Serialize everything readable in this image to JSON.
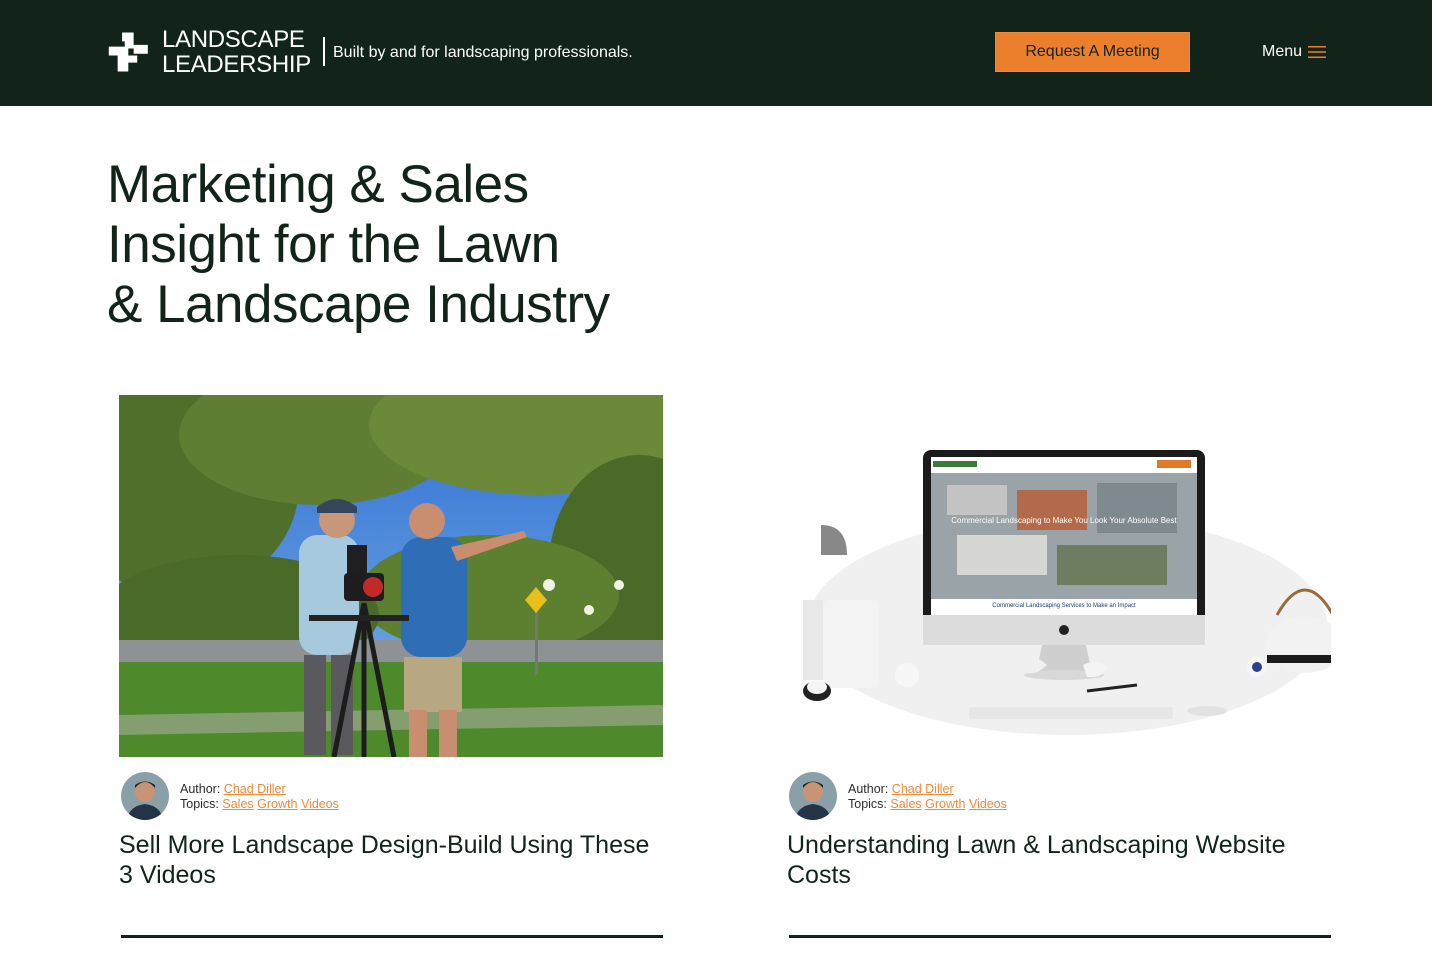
{
  "header": {
    "logo_line1": "LANDSCAPE",
    "logo_line2": "LEADERSHIP",
    "tagline": "Built by and for landscaping professionals.",
    "cta_label": "Request A Meeting",
    "menu_label": "Menu",
    "menu_icon": "hamburger-icon",
    "colors": {
      "bg": "#12241a",
      "accent": "#ec7f2c"
    }
  },
  "page": {
    "title_line1": "Marketing & Sales",
    "title_line2": "Insight for the Lawn",
    "title_line3": "& Landscape Industry"
  },
  "posts": [
    {
      "author_label": "Author:",
      "author": "Chad Diller",
      "topics_label": "Topics:",
      "topics": [
        "Sales",
        "Growth",
        "Videos"
      ],
      "title": "Sell More Landscape Design-Build Using These 3 Videos"
    },
    {
      "author_label": "Author:",
      "author": "Chad Diller",
      "topics_label": "Topics:",
      "topics": [
        "Sales",
        "Growth",
        "Videos"
      ],
      "title": "Understanding Lawn & Landscaping Website Costs",
      "screen_headline": "Commercial Landscaping to Make You Look Your Absolute Best",
      "screen_subline": "Commercial Landscaping Services to Make an Impact"
    }
  ]
}
